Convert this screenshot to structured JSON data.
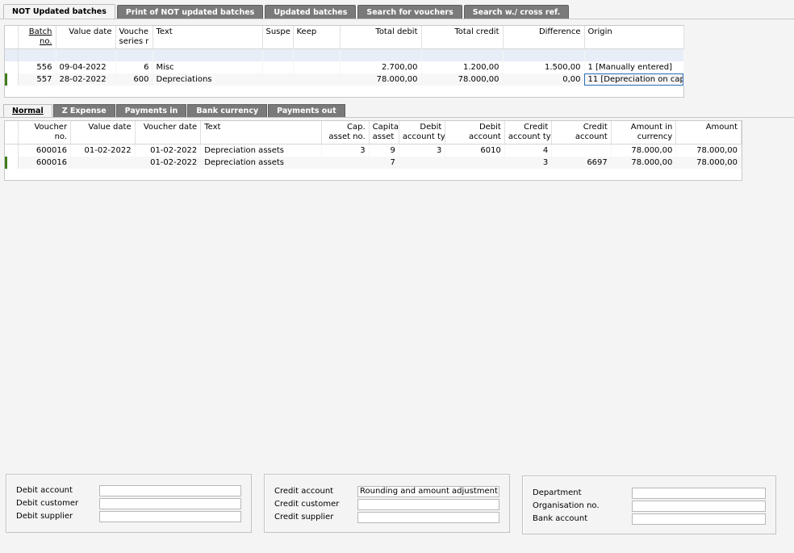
{
  "top_tabs": [
    {
      "label": "NOT Updated batches"
    },
    {
      "label": "Print of NOT updated batches"
    },
    {
      "label": "Updated batches"
    },
    {
      "label": "Search for vouchers"
    },
    {
      "label": "Search w./ cross ref."
    }
  ],
  "batches": {
    "headers": {
      "batch_no": [
        "Batch",
        "no."
      ],
      "value_date": "Value date",
      "voucher_series": [
        "Vouche",
        "series r"
      ],
      "text": "Text",
      "suspense": "Suspe",
      "keep": "Keep",
      "total_debit": "Total debit",
      "total_credit": "Total credit",
      "difference": "Difference",
      "origin": "Origin"
    },
    "rows": [
      {
        "batch_no": "556",
        "value_date": "09-04-2022",
        "voucher_series": "6",
        "text": "Misc",
        "suspense": "",
        "keep": "",
        "total_debit": "2.700,00",
        "total_credit": "1.200,00",
        "difference": "1.500,00",
        "origin": "1 [Manually entered]"
      },
      {
        "batch_no": "557",
        "value_date": "28-02-2022",
        "voucher_series": "600",
        "text": "Depreciations",
        "suspense": "",
        "keep": "",
        "total_debit": "78.000,00",
        "total_credit": "78.000,00",
        "difference": "0,00",
        "origin": "11 [Depreciation on cap"
      }
    ]
  },
  "detail_tabs": [
    {
      "label": "Normal"
    },
    {
      "label": "Z Expense"
    },
    {
      "label": "Payments in"
    },
    {
      "label": "Bank currency"
    },
    {
      "label": "Payments out"
    }
  ],
  "vouchers": {
    "headers": {
      "voucher_no": [
        "Voucher",
        "no."
      ],
      "value_date": "Value date",
      "voucher_date": "Voucher date",
      "text": "Text",
      "cap_asset_no": [
        "Cap.",
        "asset no."
      ],
      "capital_asset": [
        "Capita",
        "asset"
      ],
      "debit_account_type": [
        "Debit",
        "account ty"
      ],
      "debit_account": [
        "Debit",
        "account"
      ],
      "credit_account_type": [
        "Credit",
        "account ty"
      ],
      "credit_account": [
        "Credit",
        "account"
      ],
      "amount_in_currency": [
        "Amount in",
        "currency"
      ],
      "amount": "Amount"
    },
    "rows": [
      {
        "voucher_no": "600016",
        "value_date": "01-02-2022",
        "voucher_date": "01-02-2022",
        "text": "Depreciation assets",
        "cap_asset_no": "3",
        "capital_asset": "9",
        "debit_account_type": "3",
        "debit_account": "6010",
        "credit_account_type": "4",
        "credit_account": "",
        "amount_in_currency": "78.000,00",
        "amount": "78.000,00"
      },
      {
        "voucher_no": "600016",
        "value_date": "",
        "voucher_date": "01-02-2022",
        "text": "Depreciation assets",
        "cap_asset_no": "",
        "capital_asset": "7",
        "debit_account_type": "",
        "debit_account": "",
        "credit_account_type": "3",
        "credit_account": "6697",
        "amount_in_currency": "78.000,00",
        "amount": "78.000,00"
      }
    ]
  },
  "debit_panel": {
    "debit_account_label": "Debit account",
    "debit_account_value": "",
    "debit_customer_label": "Debit customer",
    "debit_customer_value": "",
    "debit_supplier_label": "Debit supplier",
    "debit_supplier_value": ""
  },
  "credit_panel": {
    "credit_account_label": "Credit account",
    "credit_account_value": "Rounding and amount adjustment",
    "credit_customer_label": "Credit customer",
    "credit_customer_value": "",
    "credit_supplier_label": "Credit supplier",
    "credit_supplier_value": ""
  },
  "org_panel": {
    "department_label": "Department",
    "department_value": "",
    "organisation_label": "Organisation no.",
    "organisation_value": "",
    "bank_account_label": "Bank account",
    "bank_account_value": ""
  },
  "colors": {
    "tab_bg": "#7a7a7a",
    "marker": "#3f7c1a",
    "focus": "#2a6eb5",
    "filter_row": "#e7eef8"
  }
}
